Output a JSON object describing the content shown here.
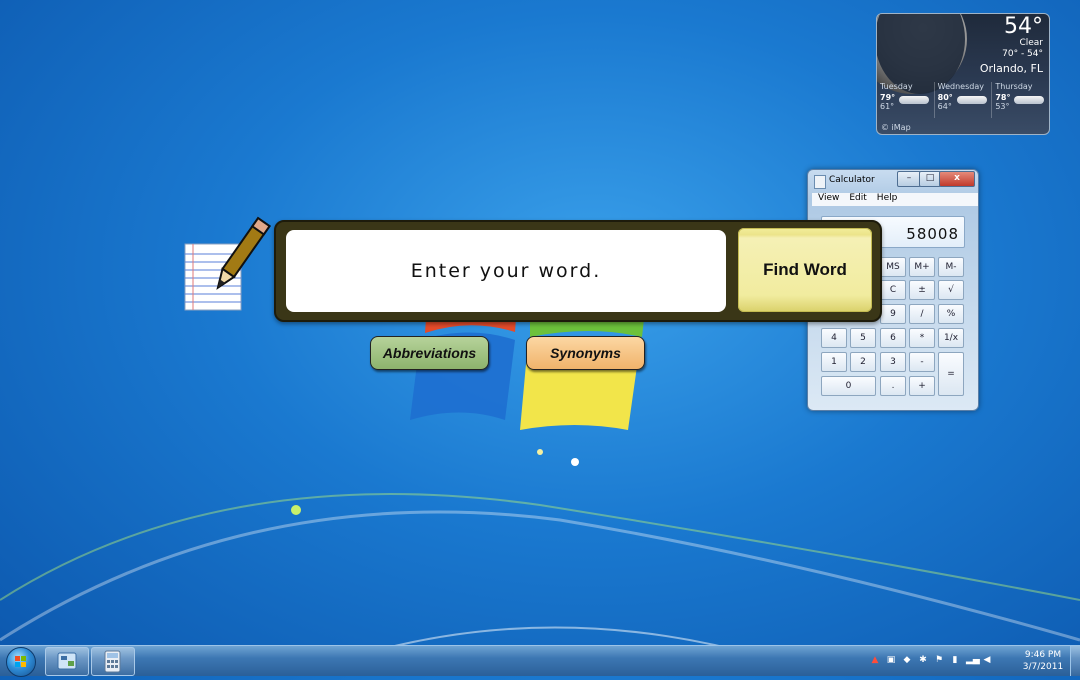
{
  "weather": {
    "temperature": "54°",
    "condition": "Clear",
    "range": "70° - 54°",
    "location": "Orlando, FL",
    "forecast": [
      {
        "day": "Tuesday",
        "high": "79°",
        "low": "61°",
        "icon": "cloudy-icon"
      },
      {
        "day": "Wednesday",
        "high": "80°",
        "low": "64°",
        "icon": "cloudy-icon"
      },
      {
        "day": "Thursday",
        "high": "78°",
        "low": "53°",
        "icon": "storm-icon"
      }
    ],
    "credit": "© iMap"
  },
  "calculator": {
    "title": "Calculator",
    "menu": [
      "View",
      "Edit",
      "Help"
    ],
    "display": "58008",
    "keys_row1": [
      "MS",
      "M+",
      "M-"
    ],
    "keys_row2": [
      "C",
      "±",
      "√"
    ],
    "keys_row3": [
      "9",
      "/",
      "%"
    ],
    "keys_row4": [
      "4",
      "5",
      "6",
      "*",
      "1/x"
    ],
    "keys_row5": [
      "1",
      "2",
      "3",
      "-",
      "="
    ],
    "keys_row6": [
      "0",
      ".",
      "+"
    ],
    "win_min": "–",
    "win_max": "□",
    "win_close": "x"
  },
  "finder": {
    "input_placeholder": "Enter your word.",
    "input_value": "",
    "find_label": "Find Word",
    "abbreviations_label": "Abbreviations",
    "synonyms_label": "Synonyms"
  },
  "taskbar": {
    "time": "9:46 PM",
    "date": "3/7/2011",
    "tray_icons": [
      "pdf-icon",
      "network-drive-icon",
      "dropbox-icon",
      "bluetooth-icon",
      "action-center-icon",
      "battery-icon",
      "signal-icon",
      "volume-icon"
    ]
  },
  "colors": {
    "finder_frame": "#3a3617",
    "find_button": "#f1ec9f",
    "abbreviations": "#a6c586",
    "synonyms": "#f6c68a"
  }
}
